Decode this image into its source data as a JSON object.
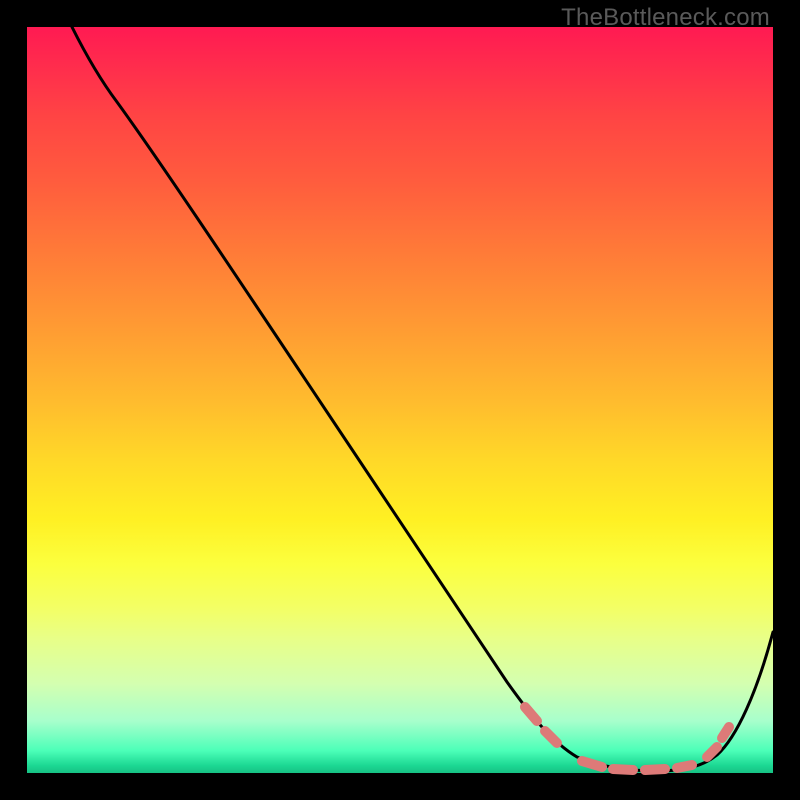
{
  "watermark": "TheBottleneck.com",
  "chart_data": {
    "type": "line",
    "title": "",
    "xlabel": "",
    "ylabel": "",
    "xlim": [
      0,
      100
    ],
    "ylim": [
      0,
      100
    ],
    "series": [
      {
        "name": "curve",
        "x": [
          6,
          12,
          20,
          30,
          40,
          50,
          60,
          66,
          70,
          74,
          78,
          82,
          86,
          90,
          94,
          100
        ],
        "values": [
          100,
          92,
          80,
          65,
          50,
          35,
          20,
          10,
          5,
          2,
          0.5,
          0.3,
          0.5,
          2,
          8,
          24
        ]
      }
    ],
    "dashed_segments_x": [
      [
        66,
        70
      ],
      [
        73,
        82
      ],
      [
        84,
        88
      ],
      [
        90,
        92
      ]
    ],
    "dash_color": "#e08080",
    "curve_color": "#000000"
  }
}
